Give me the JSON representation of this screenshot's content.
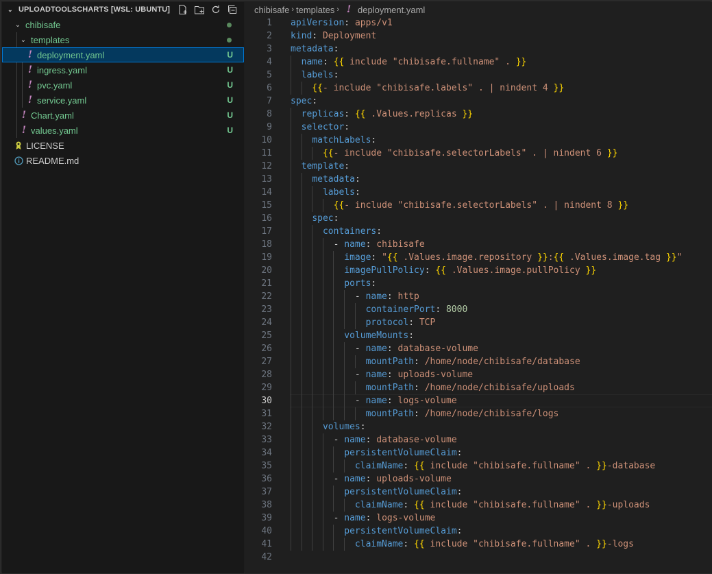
{
  "explorer": {
    "title": "UPLOADTOOLSCHARTS [WSL: UBUNTU]",
    "actions": [
      "new-file-icon",
      "new-folder-icon",
      "refresh-icon",
      "collapse-all-icon"
    ],
    "items": [
      {
        "label": "chibisafe",
        "kind": "folder",
        "status": "dot"
      },
      {
        "label": "templates",
        "kind": "folder",
        "status": "dot"
      },
      {
        "label": "deployment.yaml",
        "kind": "yaml",
        "status": "U"
      },
      {
        "label": "ingress.yaml",
        "kind": "yaml",
        "status": "U"
      },
      {
        "label": "pvc.yaml",
        "kind": "yaml",
        "status": "U"
      },
      {
        "label": "service.yaml",
        "kind": "yaml",
        "status": "U"
      },
      {
        "label": "Chart.yaml",
        "kind": "yaml",
        "status": "U"
      },
      {
        "label": "values.yaml",
        "kind": "yaml",
        "status": "U"
      },
      {
        "label": "LICENSE",
        "kind": "license",
        "status": ""
      },
      {
        "label": "README.md",
        "kind": "info",
        "status": ""
      }
    ],
    "yaml_glyph": "!"
  },
  "breadcrumb": {
    "parts": [
      "chibisafe",
      "templates",
      "deployment.yaml"
    ],
    "separator": "›"
  },
  "editor": {
    "active_line": 30,
    "lines": [
      "apiVersion: apps/v1",
      "kind: Deployment",
      "metadata:",
      "  name: {{ include \"chibisafe.fullname\" . }}",
      "  labels:",
      "    {{- include \"chibisafe.labels\" . | nindent 4 }}",
      "spec:",
      "  replicas: {{ .Values.replicas }}",
      "  selector:",
      "    matchLabels:",
      "      {{- include \"chibisafe.selectorLabels\" . | nindent 6 }}",
      "  template:",
      "    metadata:",
      "      labels:",
      "        {{- include \"chibisafe.selectorLabels\" . | nindent 8 }}",
      "    spec:",
      "      containers:",
      "        - name: chibisafe",
      "          image: \"{{ .Values.image.repository }}:{{ .Values.image.tag }}\"",
      "          imagePullPolicy: {{ .Values.image.pullPolicy }}",
      "          ports:",
      "            - name: http",
      "              containerPort: 8000",
      "              protocol: TCP",
      "          volumeMounts:",
      "            - name: database-volume",
      "              mountPath: /home/node/chibisafe/database",
      "            - name: uploads-volume",
      "              mountPath: /home/node/chibisafe/uploads",
      "            - name: logs-volume",
      "              mountPath: /home/node/chibisafe/logs",
      "      volumes:",
      "        - name: database-volume",
      "          persistentVolumeClaim:",
      "            claimName: {{ include \"chibisafe.fullname\" . }}-database",
      "        - name: uploads-volume",
      "          persistentVolumeClaim:",
      "            claimName: {{ include \"chibisafe.fullname\" . }}-uploads",
      "        - name: logs-volume",
      "          persistentVolumeClaim:",
      "            claimName: {{ include \"chibisafe.fullname\" . }}-logs",
      ""
    ]
  },
  "colors": {
    "key": "#569cd6",
    "string": "#ce9178",
    "number": "#b5cea8",
    "bracket_outer": "#ffd700",
    "bracket_inner": "#da70d6",
    "untracked": "#73c991",
    "selection": "#04395e"
  }
}
